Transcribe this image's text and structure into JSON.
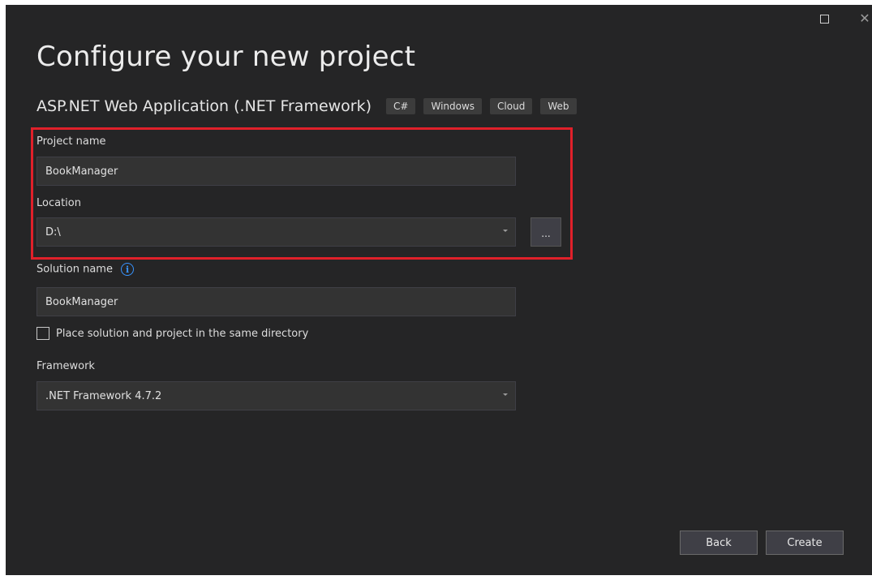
{
  "window": {
    "maximize_icon": "maximize-icon",
    "close_icon": "close-icon",
    "close_glyph": "✕"
  },
  "header": {
    "title": "Configure your new project",
    "template_name": "ASP.NET Web Application (.NET Framework)",
    "tags": [
      "C#",
      "Windows",
      "Cloud",
      "Web"
    ]
  },
  "form": {
    "project_name_label": "Project name",
    "project_name_value": "BookManager",
    "location_label": "Location",
    "location_value": "D:\\",
    "browse_label": "...",
    "solution_name_label": "Solution name",
    "solution_info_glyph": "i",
    "solution_name_value": "BookManager",
    "same_directory_label": "Place solution and project in the same directory",
    "same_directory_checked": false,
    "framework_label": "Framework",
    "framework_value": ".NET Framework 4.7.2"
  },
  "footer": {
    "back_label": "Back",
    "create_label": "Create"
  },
  "colors": {
    "background": "#252526",
    "field_background": "#333333",
    "highlight": "#e0202a",
    "info_accent": "#3794ff"
  }
}
